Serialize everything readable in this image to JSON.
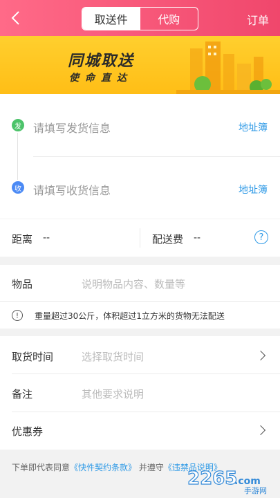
{
  "header": {
    "tabs": [
      {
        "label": "取送件",
        "active": true
      },
      {
        "label": "代购",
        "active": false
      }
    ],
    "orders_label": "订单"
  },
  "banner": {
    "title": "同城取送",
    "subtitle": "使命直达"
  },
  "address": {
    "sender": {
      "badge": "发",
      "placeholder": "请填写发货信息",
      "link": "地址簿"
    },
    "receiver": {
      "badge": "收",
      "placeholder": "请填写收货信息",
      "link": "地址簿"
    }
  },
  "distance": {
    "distance_label": "距离",
    "distance_value": "--",
    "fee_label": "配送费",
    "fee_value": "--",
    "help_glyph": "?"
  },
  "goods": {
    "label": "物品",
    "placeholder": "说明物品内容、数量等",
    "warning": "重量超过30公斤，体积超过1立方米的货物无法配送"
  },
  "options": {
    "pickup_time_label": "取货时间",
    "pickup_time_placeholder": "选择取货时间",
    "remark_label": "备注",
    "remark_placeholder": "其他要求说明",
    "coupon_label": "优惠券"
  },
  "footer": {
    "prefix": "下单即代表同意",
    "terms_link": "《快件契约条款》",
    "middle": "并遵守",
    "prohibited_link": "《违禁品说明》"
  },
  "watermark": {
    "number": "2265",
    "dotcom": ".com",
    "text": "手游网"
  },
  "colors": {
    "header_start": "#ff6a88",
    "header_end": "#f0476c",
    "banner": "#ffc21f",
    "link": "#2f9ae6",
    "send_dot": "#4cc36a",
    "recv_dot": "#4b8af5"
  }
}
